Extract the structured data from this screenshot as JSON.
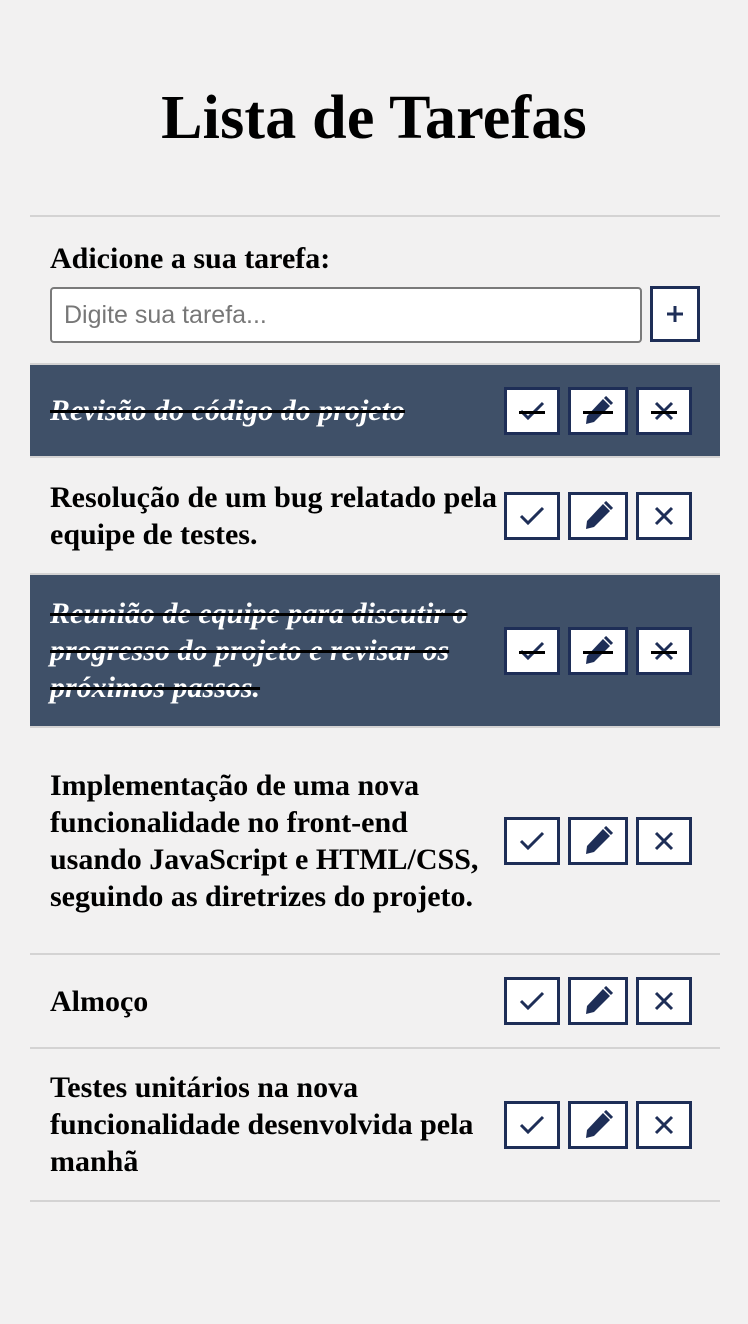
{
  "title": "Lista de Tarefas",
  "add_form": {
    "label": "Adicione a sua tarefa:",
    "placeholder": "Digite sua tarefa...",
    "value": "",
    "add_button_icon": "plus-icon"
  },
  "actions": {
    "done_icon": "check-icon",
    "edit_icon": "pencil-icon",
    "remove_icon": "x-icon"
  },
  "colors": {
    "background": "#f2f1f1",
    "done_row": "#3f5068",
    "button_border": "#1e2e57"
  },
  "tasks": [
    {
      "text": "Revisão do código do projeto",
      "done": true
    },
    {
      "text": "Resolução de um bug relatado pela equipe de testes.",
      "done": false
    },
    {
      "text": "Reunião de equipe para discutir o progresso do projeto e revisar os próximos passos.",
      "done": true
    },
    {
      "text": "Implementação de uma nova funcionalidade no front-end usando JavaScript e HTML/CSS, seguindo as diretrizes do projeto.",
      "done": false
    },
    {
      "text": "Almoço",
      "done": false
    },
    {
      "text": "Testes unitários na nova funcionalidade desenvolvida pela manhã",
      "done": false
    }
  ]
}
